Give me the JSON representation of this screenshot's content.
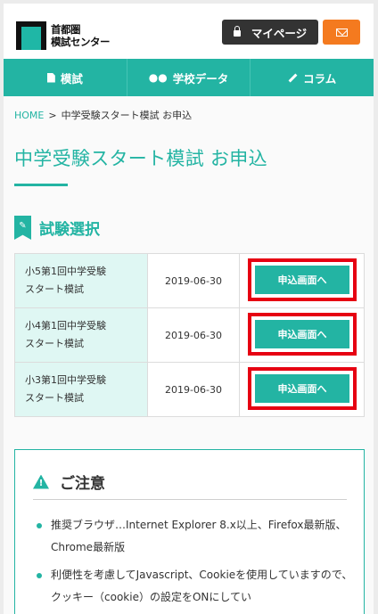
{
  "header": {
    "logo_line1": "首都圏",
    "logo_line2": "模試センター",
    "mypage_label": "マイページ",
    "lock_icon": "lock-icon",
    "mail_icon": "envelope-icon"
  },
  "nav": {
    "items": [
      {
        "label": "模試",
        "icon": "document-icon"
      },
      {
        "label": "学校データ",
        "icon": "binoculars-icon"
      },
      {
        "label": "コラム",
        "icon": "pencil-icon"
      }
    ]
  },
  "breadcrumb": {
    "home": "HOME",
    "separator": ">",
    "current": "中学受験スタート模試 お申込"
  },
  "page_title": "中学受験スタート模試 お申込",
  "section": {
    "title": "試験選択",
    "icon": "pencil-bookmark-icon"
  },
  "exams": [
    {
      "name_line1": "小5第1回中学受験",
      "name_line2": "スタート模試",
      "date": "2019-06-30",
      "button": "申込画面へ"
    },
    {
      "name_line1": "小4第1回中学受験",
      "name_line2": "スタート模試",
      "date": "2019-06-30",
      "button": "申込画面へ"
    },
    {
      "name_line1": "小3第1回中学受験",
      "name_line2": "スタート模試",
      "date": "2019-06-30",
      "button": "申込画面へ"
    }
  ],
  "notice": {
    "title": "ご注意",
    "icon": "warning-icon",
    "items": [
      "推奨ブラウザ…Internet Explorer 8.x以上、Firefox最新版、Chrome最新版",
      "利便性を考慮してJavascript、Cookieを使用していますので、クッキー（cookie）の設定をONにしてい"
    ]
  },
  "colors": {
    "accent": "#23b4a3",
    "highlight": "#e60012",
    "mail_button": "#f47a1f",
    "mypage_button": "#333333"
  }
}
